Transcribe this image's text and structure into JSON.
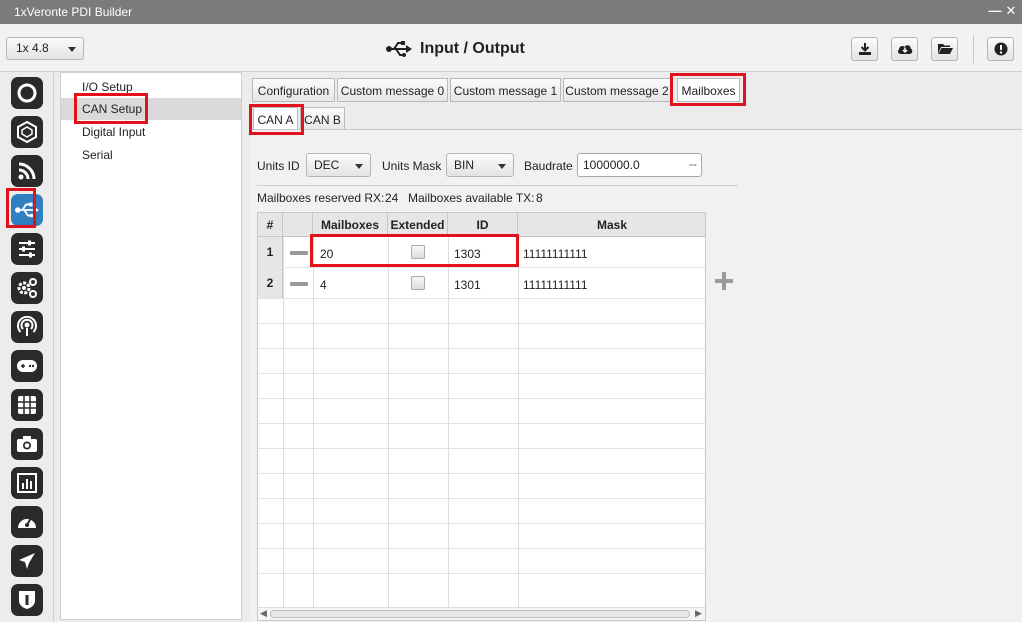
{
  "window": {
    "title": "1xVeronte PDI Builder",
    "controls": [
      "—",
      "✕"
    ]
  },
  "toolbar": {
    "version": "1x 4.8",
    "page_title": "Input / Output",
    "buttons": [
      "download-icon",
      "cloud-download-icon",
      "folder-open-icon",
      "info-icon"
    ]
  },
  "rail": {
    "items": [
      "power-ring-icon",
      "hexagon-icon",
      "rss-icon",
      "usb-icon",
      "sliders-icon",
      "gears-icon",
      "broadcast-icon",
      "gamepad-icon",
      "grid-icon",
      "camera-icon",
      "bar-chart-icon",
      "gauge-icon",
      "plane-icon",
      "shield-icon"
    ],
    "active": "usb-icon",
    "accent": "#2f7fc1"
  },
  "nav": {
    "items": [
      "I/O Setup",
      "CAN Setup",
      "Digital Input",
      "Serial"
    ],
    "selected": "CAN Setup"
  },
  "tabs": {
    "items": [
      "Configuration",
      "Custom message 0",
      "Custom message 1",
      "Custom message 2",
      "Mailboxes"
    ],
    "selected": "Mailboxes"
  },
  "subtabs": {
    "items": [
      "CAN A",
      "CAN B"
    ],
    "selected": "CAN A"
  },
  "settings": {
    "units_id_label": "Units ID",
    "units_id_value": "DEC",
    "units_mask_label": "Units Mask",
    "units_mask_value": "BIN",
    "baudrate_label": "Baudrate",
    "baudrate_value": "1000000.0",
    "baudrate_suffix": "--"
  },
  "summary": {
    "reserved_rx_label": "Mailboxes reserved RX:",
    "reserved_rx_value": "24",
    "available_tx_label": "Mailboxes available TX:",
    "available_tx_value": "8"
  },
  "table": {
    "columns": [
      "#",
      "",
      "Mailboxes",
      "Extended",
      "ID",
      "Mask"
    ],
    "rows": [
      {
        "num": "1",
        "mailboxes": "20",
        "extended": false,
        "id": "1303",
        "mask": "11111111111"
      },
      {
        "num": "2",
        "mailboxes": "4",
        "extended": false,
        "id": "1301",
        "mask": "11111111111"
      }
    ]
  },
  "highlight_color": "#e0131d"
}
